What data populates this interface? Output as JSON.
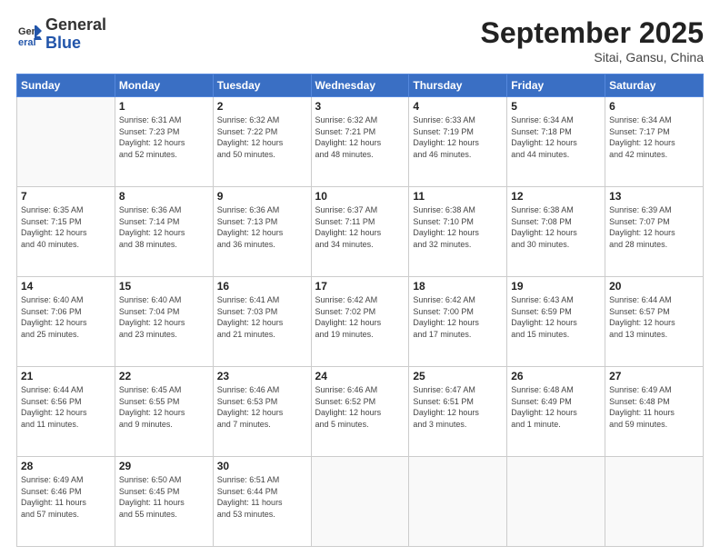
{
  "header": {
    "logo_general": "General",
    "logo_blue": "Blue",
    "month_title": "September 2025",
    "location": "Sitai, Gansu, China"
  },
  "columns": [
    "Sunday",
    "Monday",
    "Tuesday",
    "Wednesday",
    "Thursday",
    "Friday",
    "Saturday"
  ],
  "weeks": [
    [
      {
        "day": "",
        "info": ""
      },
      {
        "day": "1",
        "info": "Sunrise: 6:31 AM\nSunset: 7:23 PM\nDaylight: 12 hours\nand 52 minutes."
      },
      {
        "day": "2",
        "info": "Sunrise: 6:32 AM\nSunset: 7:22 PM\nDaylight: 12 hours\nand 50 minutes."
      },
      {
        "day": "3",
        "info": "Sunrise: 6:32 AM\nSunset: 7:21 PM\nDaylight: 12 hours\nand 48 minutes."
      },
      {
        "day": "4",
        "info": "Sunrise: 6:33 AM\nSunset: 7:19 PM\nDaylight: 12 hours\nand 46 minutes."
      },
      {
        "day": "5",
        "info": "Sunrise: 6:34 AM\nSunset: 7:18 PM\nDaylight: 12 hours\nand 44 minutes."
      },
      {
        "day": "6",
        "info": "Sunrise: 6:34 AM\nSunset: 7:17 PM\nDaylight: 12 hours\nand 42 minutes."
      }
    ],
    [
      {
        "day": "7",
        "info": "Sunrise: 6:35 AM\nSunset: 7:15 PM\nDaylight: 12 hours\nand 40 minutes."
      },
      {
        "day": "8",
        "info": "Sunrise: 6:36 AM\nSunset: 7:14 PM\nDaylight: 12 hours\nand 38 minutes."
      },
      {
        "day": "9",
        "info": "Sunrise: 6:36 AM\nSunset: 7:13 PM\nDaylight: 12 hours\nand 36 minutes."
      },
      {
        "day": "10",
        "info": "Sunrise: 6:37 AM\nSunset: 7:11 PM\nDaylight: 12 hours\nand 34 minutes."
      },
      {
        "day": "11",
        "info": "Sunrise: 6:38 AM\nSunset: 7:10 PM\nDaylight: 12 hours\nand 32 minutes."
      },
      {
        "day": "12",
        "info": "Sunrise: 6:38 AM\nSunset: 7:08 PM\nDaylight: 12 hours\nand 30 minutes."
      },
      {
        "day": "13",
        "info": "Sunrise: 6:39 AM\nSunset: 7:07 PM\nDaylight: 12 hours\nand 28 minutes."
      }
    ],
    [
      {
        "day": "14",
        "info": "Sunrise: 6:40 AM\nSunset: 7:06 PM\nDaylight: 12 hours\nand 25 minutes."
      },
      {
        "day": "15",
        "info": "Sunrise: 6:40 AM\nSunset: 7:04 PM\nDaylight: 12 hours\nand 23 minutes."
      },
      {
        "day": "16",
        "info": "Sunrise: 6:41 AM\nSunset: 7:03 PM\nDaylight: 12 hours\nand 21 minutes."
      },
      {
        "day": "17",
        "info": "Sunrise: 6:42 AM\nSunset: 7:02 PM\nDaylight: 12 hours\nand 19 minutes."
      },
      {
        "day": "18",
        "info": "Sunrise: 6:42 AM\nSunset: 7:00 PM\nDaylight: 12 hours\nand 17 minutes."
      },
      {
        "day": "19",
        "info": "Sunrise: 6:43 AM\nSunset: 6:59 PM\nDaylight: 12 hours\nand 15 minutes."
      },
      {
        "day": "20",
        "info": "Sunrise: 6:44 AM\nSunset: 6:57 PM\nDaylight: 12 hours\nand 13 minutes."
      }
    ],
    [
      {
        "day": "21",
        "info": "Sunrise: 6:44 AM\nSunset: 6:56 PM\nDaylight: 12 hours\nand 11 minutes."
      },
      {
        "day": "22",
        "info": "Sunrise: 6:45 AM\nSunset: 6:55 PM\nDaylight: 12 hours\nand 9 minutes."
      },
      {
        "day": "23",
        "info": "Sunrise: 6:46 AM\nSunset: 6:53 PM\nDaylight: 12 hours\nand 7 minutes."
      },
      {
        "day": "24",
        "info": "Sunrise: 6:46 AM\nSunset: 6:52 PM\nDaylight: 12 hours\nand 5 minutes."
      },
      {
        "day": "25",
        "info": "Sunrise: 6:47 AM\nSunset: 6:51 PM\nDaylight: 12 hours\nand 3 minutes."
      },
      {
        "day": "26",
        "info": "Sunrise: 6:48 AM\nSunset: 6:49 PM\nDaylight: 12 hours\nand 1 minute."
      },
      {
        "day": "27",
        "info": "Sunrise: 6:49 AM\nSunset: 6:48 PM\nDaylight: 11 hours\nand 59 minutes."
      }
    ],
    [
      {
        "day": "28",
        "info": "Sunrise: 6:49 AM\nSunset: 6:46 PM\nDaylight: 11 hours\nand 57 minutes."
      },
      {
        "day": "29",
        "info": "Sunrise: 6:50 AM\nSunset: 6:45 PM\nDaylight: 11 hours\nand 55 minutes."
      },
      {
        "day": "30",
        "info": "Sunrise: 6:51 AM\nSunset: 6:44 PM\nDaylight: 11 hours\nand 53 minutes."
      },
      {
        "day": "",
        "info": ""
      },
      {
        "day": "",
        "info": ""
      },
      {
        "day": "",
        "info": ""
      },
      {
        "day": "",
        "info": ""
      }
    ]
  ]
}
